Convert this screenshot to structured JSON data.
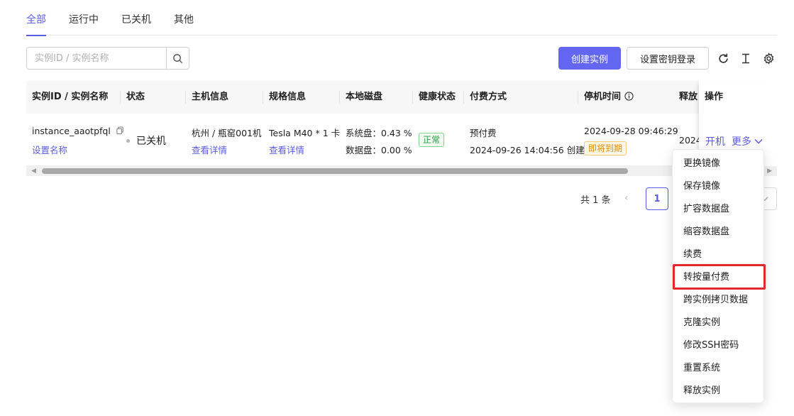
{
  "tabs": [
    {
      "label": "全部",
      "active": true
    },
    {
      "label": "运行中",
      "active": false
    },
    {
      "label": "已关机",
      "active": false
    },
    {
      "label": "其他",
      "active": false
    }
  ],
  "toolbar": {
    "search_placeholder": "实例ID / 实例名称",
    "create_label": "创建实例",
    "set_key_label": "设置密钥登录"
  },
  "table": {
    "headers": {
      "instance": "实例ID / 实例名称",
      "status": "状态",
      "host": "主机信息",
      "spec": "规格信息",
      "disk": "本地磁盘",
      "health": "健康状态",
      "billing": "付费方式",
      "stop_time": "停机时间",
      "release": "释放",
      "ops": "操作"
    },
    "row": {
      "instance_id": "instance_aaotpfql",
      "set_name": "设置名称",
      "status": "已关机",
      "host": "杭州 / 瓶窑001机",
      "host_detail": "查看详情",
      "spec": "Tesla M40 * 1 卡",
      "spec_detail": "查看详情",
      "disk_system": "系统盘：0.43 %",
      "disk_data": "数据盘：0.00 %",
      "health": "正常",
      "billing_type": "预付费",
      "billing_created": "2024-09-26 14:04:56 创建",
      "stop_time": "2024-09-28 09:46:29",
      "expiring": "即将到期",
      "release": "2024",
      "op_start": "开机",
      "op_more": "更多"
    }
  },
  "pagination": {
    "total": "共 1 条",
    "current": "1"
  },
  "dropdown": {
    "items": [
      "更换镜像",
      "保存镜像",
      "扩容数据盘",
      "缩容数据盘",
      "续费",
      "转按量付费",
      "跨实例拷贝数据",
      "克隆实例",
      "修改SSH密码",
      "重置系统",
      "释放实例"
    ],
    "highlighted_index": 5
  },
  "colors": {
    "primary": "#6366f1",
    "link": "#5b5ce6",
    "highlight_border": "#e3272d",
    "healthy": "#2d9d46",
    "warning": "#e58a00"
  }
}
